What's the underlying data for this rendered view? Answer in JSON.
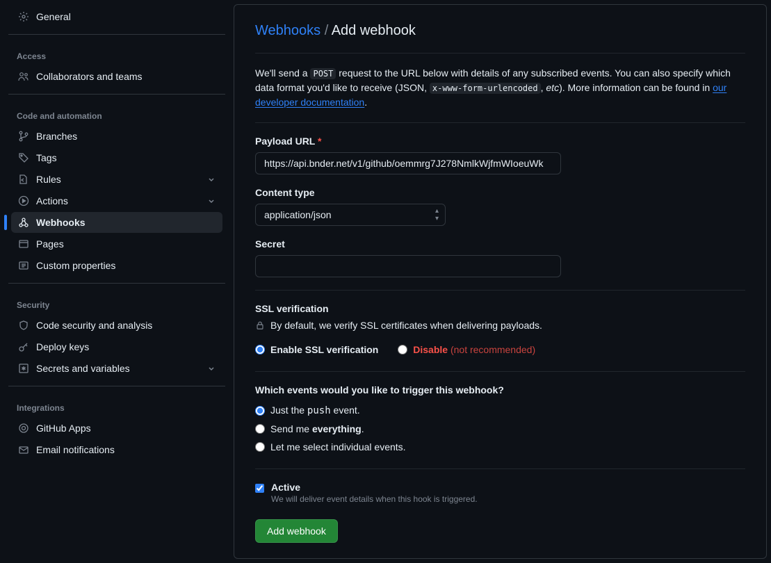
{
  "sidebar": {
    "general": "General",
    "sections": {
      "access": {
        "title": "Access",
        "items": [
          {
            "label": "Collaborators and teams"
          }
        ]
      },
      "code": {
        "title": "Code and automation",
        "items": [
          {
            "label": "Branches"
          },
          {
            "label": "Tags"
          },
          {
            "label": "Rules",
            "expandable": true
          },
          {
            "label": "Actions",
            "expandable": true
          },
          {
            "label": "Webhooks",
            "active": true
          },
          {
            "label": "Pages"
          },
          {
            "label": "Custom properties"
          }
        ]
      },
      "security": {
        "title": "Security",
        "items": [
          {
            "label": "Code security and analysis"
          },
          {
            "label": "Deploy keys"
          },
          {
            "label": "Secrets and variables",
            "expandable": true
          }
        ]
      },
      "integrations": {
        "title": "Integrations",
        "items": [
          {
            "label": "GitHub Apps"
          },
          {
            "label": "Email notifications"
          }
        ]
      }
    }
  },
  "breadcrumb": {
    "parent": "Webhooks",
    "sep": "/",
    "current": "Add webhook"
  },
  "description": {
    "t1": "We'll send a ",
    "code1": "POST",
    "t2": " request to the URL below with details of any subscribed events. You can also specify which data format you'd like to receive (JSON, ",
    "code2": "x-www-form-urlencoded",
    "t3": ", ",
    "etc": "etc",
    "t4": "). More information can be found in ",
    "link": "our developer documentation",
    "t5": "."
  },
  "form": {
    "payload_label": "Payload URL",
    "payload_value": "https://api.bnder.net/v1/github/oemmrg7J278NmlkWjfmWIoeuWk",
    "content_type_label": "Content type",
    "content_type_value": "application/json",
    "secret_label": "Secret",
    "secret_value": ""
  },
  "ssl": {
    "heading": "SSL verification",
    "note": "By default, we verify SSL certificates when delivering payloads.",
    "enable": "Enable SSL verification",
    "disable": "Disable",
    "disable_note": "(not recommended)"
  },
  "events": {
    "heading": "Which events would you like to trigger this webhook?",
    "opt1_a": "Just the ",
    "opt1_code": "push",
    "opt1_b": " event.",
    "opt2_a": "Send me ",
    "opt2_strong": "everything",
    "opt2_b": ".",
    "opt3": "Let me select individual events."
  },
  "active": {
    "label": "Active",
    "note": "We will deliver event details when this hook is triggered."
  },
  "submit": "Add webhook"
}
